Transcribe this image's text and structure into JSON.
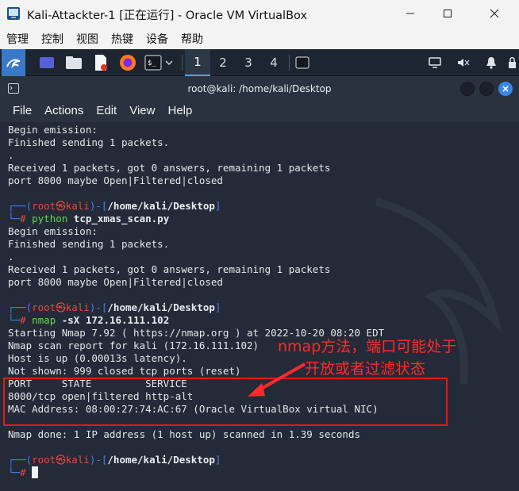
{
  "window": {
    "title": "Kali-Attackter-1 [正在运行] - Oracle VM VirtualBox"
  },
  "vbox_menu": [
    "管理",
    "控制",
    "视图",
    "热键",
    "设备",
    "帮助"
  ],
  "panel": {
    "workspaces": [
      "1",
      "2",
      "3",
      "4"
    ],
    "active_workspace": "1"
  },
  "terminal": {
    "title": "root@kali: /home/kali/Desktop",
    "menu": [
      "File",
      "Actions",
      "Edit",
      "View",
      "Help"
    ],
    "lines": [
      {
        "type": "out",
        "text": "Begin emission:"
      },
      {
        "type": "out",
        "text": "Finished sending 1 packets."
      },
      {
        "type": "out",
        "text": "."
      },
      {
        "type": "out",
        "text": "Received 1 packets, got 0 answers, remaining 1 packets"
      },
      {
        "type": "out",
        "text": "port 8000 maybe Open|Filtered|closed"
      },
      {
        "type": "out",
        "text": ""
      },
      {
        "type": "p1",
        "user": "root",
        "skull": "㉿",
        "host": "kali",
        "path": "/home/kali/Desktop"
      },
      {
        "type": "p2",
        "c1": "python",
        "c2": " tcp_xmas_scan.py"
      },
      {
        "type": "out",
        "text": "Begin emission:"
      },
      {
        "type": "out",
        "text": "Finished sending 1 packets."
      },
      {
        "type": "out",
        "text": "."
      },
      {
        "type": "out",
        "text": "Received 1 packets, got 0 answers, remaining 1 packets"
      },
      {
        "type": "out",
        "text": "port 8000 maybe Open|Filtered|closed"
      },
      {
        "type": "out",
        "text": ""
      },
      {
        "type": "p1",
        "user": "root",
        "skull": "㉿",
        "host": "kali",
        "path": "/home/kali/Desktop"
      },
      {
        "type": "p2",
        "c1": "nmap",
        "c2": " -sX 172.16.111.102"
      },
      {
        "type": "out",
        "text": "Starting Nmap 7.92 ( https://nmap.org ) at 2022-10-20 08:20 EDT"
      },
      {
        "type": "out",
        "text": "Nmap scan report for kali (172.16.111.102)"
      },
      {
        "type": "out",
        "text": "Host is up (0.00013s latency)."
      },
      {
        "type": "out",
        "text": "Not shown: 999 closed tcp ports (reset)"
      },
      {
        "type": "out",
        "text": "PORT     STATE         SERVICE"
      },
      {
        "type": "out",
        "text": "8000/tcp open|filtered http-alt"
      },
      {
        "type": "out",
        "text": "MAC Address: 08:00:27:74:AC:67 (Oracle VirtualBox virtual NIC)"
      },
      {
        "type": "out",
        "text": ""
      },
      {
        "type": "out",
        "text": "Nmap done: 1 IP address (1 host up) scanned in 1.39 seconds"
      },
      {
        "type": "out",
        "text": ""
      },
      {
        "type": "p1",
        "user": "root",
        "skull": "㉿",
        "host": "kali",
        "path": "/home/kali/Desktop"
      },
      {
        "type": "p2cursor"
      }
    ]
  },
  "annotation": {
    "line1": "nmap方法，端口可能处于",
    "line2": "开放或者过滤状态",
    "color": "#ff2a2a"
  },
  "colors": {
    "terminal_bg": "#242a37",
    "prompt_blue": "#3b83f5",
    "prompt_red": "#f0463d",
    "command_green": "#64d94e"
  }
}
